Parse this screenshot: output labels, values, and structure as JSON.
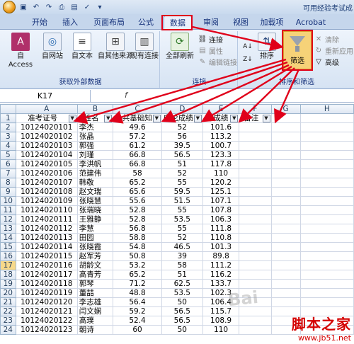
{
  "window_title": "可用经验考试成",
  "tabs": [
    "开始",
    "插入",
    "页面布局",
    "公式",
    "数据",
    "审阅",
    "视图",
    "加载项",
    "Acrobat"
  ],
  "ribbon": {
    "get_external": {
      "label": "获取外部数据",
      "buttons": [
        "自 Access",
        "自网站",
        "自文本",
        "自其他来源",
        "现有连接"
      ]
    },
    "connections": {
      "label": "连接",
      "refresh_all": "全部刷新",
      "items": [
        "连接",
        "属性",
        "编辑链接"
      ]
    },
    "sort_filter": {
      "label": "排序和筛选",
      "sort": "排序",
      "filter": "筛选",
      "items": [
        "清除",
        "重新应用",
        "高级"
      ]
    }
  },
  "formula_bar": {
    "name_box": "K17",
    "fx": "f"
  },
  "sheet": {
    "columns": [
      "A",
      "B",
      "C",
      "D",
      "E",
      "F",
      "G",
      "H"
    ],
    "header_row": [
      "准考证号",
      "姓名",
      "公共基础知",
      "申论成绩",
      "总成绩",
      "备注"
    ],
    "selected_row": 17,
    "rows": [
      [
        "10124020101",
        "李杰",
        "49.6",
        "52",
        "101.6"
      ],
      [
        "10124020102",
        "张晶",
        "57.2",
        "56",
        "113.2"
      ],
      [
        "10124020103",
        "郭强",
        "61.2",
        "39.5",
        "100.7"
      ],
      [
        "10124020104",
        "刘瑾",
        "66.8",
        "56.5",
        "123.3"
      ],
      [
        "10124020105",
        "李洪帆",
        "66.8",
        "51",
        "117.8"
      ],
      [
        "10124020106",
        "范建伟",
        "58",
        "52",
        "110"
      ],
      [
        "10124020107",
        "韩敬",
        "65.2",
        "55",
        "120.2"
      ],
      [
        "10124020108",
        "赵文瑞",
        "65.6",
        "59.5",
        "125.1"
      ],
      [
        "10124020109",
        "张晓慧",
        "55.6",
        "51.5",
        "107.1"
      ],
      [
        "10124020110",
        "张瑞晓",
        "52.8",
        "55",
        "107.8"
      ],
      [
        "10124020111",
        "王雅静",
        "52.8",
        "53.5",
        "106.3"
      ],
      [
        "10124020112",
        "李慧",
        "56.8",
        "55",
        "111.8"
      ],
      [
        "10124020113",
        "田园",
        "58.8",
        "52",
        "110.8"
      ],
      [
        "10124020114",
        "张晓霞",
        "54.8",
        "46.5",
        "101.3"
      ],
      [
        "10124020115",
        "赵军芳",
        "50.8",
        "39",
        "89.8"
      ],
      [
        "10124020116",
        "胡龄文",
        "53.2",
        "58",
        "111.2"
      ],
      [
        "10124020117",
        "高青芳",
        "65.2",
        "51",
        "116.2"
      ],
      [
        "10124020118",
        "郭琴",
        "71.2",
        "62.5",
        "133.7"
      ],
      [
        "10124020119",
        "董喆",
        "48.8",
        "53.5",
        "102.3"
      ],
      [
        "10124020120",
        "李志雄",
        "56.4",
        "50",
        "106.4"
      ],
      [
        "10124020121",
        "闫文娴",
        "59.2",
        "56.5",
        "115.7"
      ],
      [
        "10124020122",
        "高璞",
        "52.4",
        "56.5",
        "108.9"
      ],
      [
        "10124020123",
        "朝诗",
        "60",
        "50",
        "110"
      ]
    ]
  },
  "watermark": {
    "line1": "脚本之家",
    "line2": "www.jb51.net"
  },
  "colors": {
    "annotation": "#e0001a",
    "filter_highlight": "#f6d278"
  }
}
